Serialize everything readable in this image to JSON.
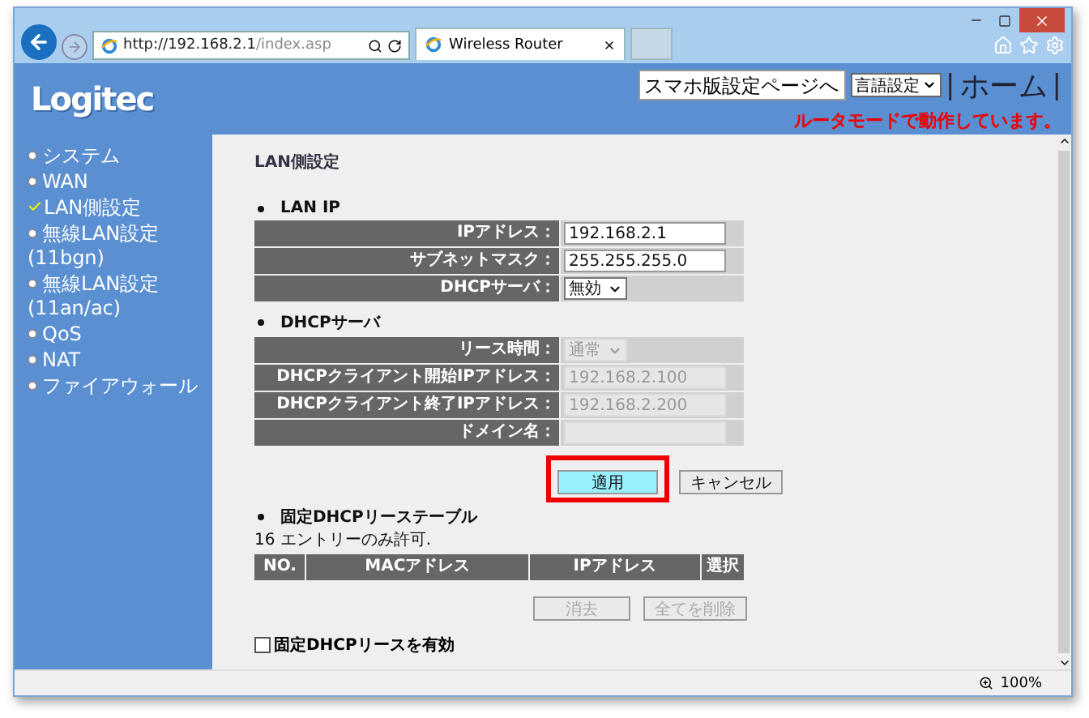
{
  "browser": {
    "url_host": "http://192.168.2.1",
    "url_path": "/index.asp",
    "tab_title": "Wireless Router",
    "zoom": "100%"
  },
  "header": {
    "logo": "Logitec",
    "mobile_button": "スマホ版設定ページへ",
    "language_select": "言語設定",
    "separators": [
      "|",
      "|"
    ],
    "home_link": "ホーム",
    "status_message": "ルータモードで動作しています。"
  },
  "sidebar": {
    "items": [
      {
        "label": "システム",
        "selected": false
      },
      {
        "label": "WAN",
        "selected": false
      },
      {
        "label": "LAN側設定",
        "selected": true
      },
      {
        "label": "無線LAN設定 (11bgn)",
        "selected": false
      },
      {
        "label": "無線LAN設定 (11an/ac)",
        "selected": false
      },
      {
        "label": "QoS",
        "selected": false
      },
      {
        "label": "NAT",
        "selected": false
      },
      {
        "label": "ファイアウォール",
        "selected": false
      }
    ]
  },
  "content": {
    "title": "LAN側設定",
    "sections": [
      {
        "heading": "LAN IP",
        "rows": [
          {
            "label": "IPアドレス：",
            "kind": "input",
            "value": "192.168.2.1",
            "disabled": false
          },
          {
            "label": "サブネットマスク：",
            "kind": "input",
            "value": "255.255.255.0",
            "disabled": false
          },
          {
            "label": "DHCPサーバ：",
            "kind": "select",
            "value": "無効",
            "disabled": false
          }
        ]
      },
      {
        "heading": "DHCPサーバ",
        "rows": [
          {
            "label": "リース時間：",
            "kind": "select",
            "value": "通常",
            "disabled": true
          },
          {
            "label": "DHCPクライアント開始IPアドレス：",
            "kind": "input",
            "value": "192.168.2.100",
            "disabled": true
          },
          {
            "label": "DHCPクライアント終了IPアドレス：",
            "kind": "input",
            "value": "192.168.2.200",
            "disabled": true
          },
          {
            "label": "ドメイン名：",
            "kind": "input",
            "value": "",
            "disabled": true
          }
        ]
      }
    ],
    "buttons": [
      {
        "label": "適用",
        "highlighted": true
      },
      {
        "label": "キャンセル",
        "highlighted": false
      }
    ],
    "lease_table": {
      "heading": "固定DHCPリーステーブル",
      "note": "16 エントリーのみ許可.",
      "columns": [
        "NO.",
        "MACアドレス",
        "IPアドレス",
        "選択"
      ],
      "buttons": [
        {
          "label": "消去",
          "disabled": true
        },
        {
          "label": "全てを削除",
          "disabled": true
        }
      ]
    },
    "enable_checkbox": {
      "label": "固定DHCPリースを有効",
      "checked": false
    }
  }
}
